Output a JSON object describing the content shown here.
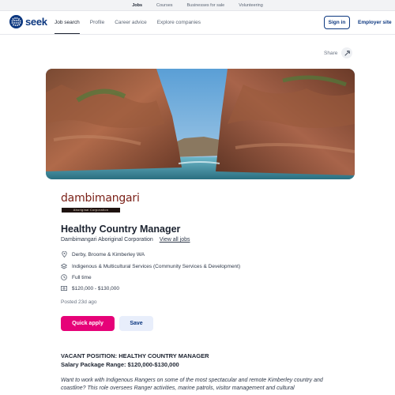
{
  "top_strip": {
    "items": [
      "Jobs",
      "Courses",
      "Businesses for sale",
      "Volunteering"
    ],
    "active_index": 0
  },
  "nav": {
    "logo_text": "seek",
    "links": [
      "Job search",
      "Profile",
      "Career advice",
      "Explore companies"
    ],
    "active_index": 0,
    "sign_in": "Sign in",
    "employer": "Employer site"
  },
  "share": {
    "label": "Share",
    "icon": "share-icon"
  },
  "banner": {
    "description_icon": "gorge-photo"
  },
  "company_logo": {
    "name": "dambimangari",
    "tagline": "Aboriginal Corporation"
  },
  "job": {
    "title": "Healthy Country Manager",
    "company": "Dambimangari Aboriginal Corporation",
    "view_all": "View all jobs",
    "location": "Derby, Broome & Kimberley WA",
    "classification": "Indigenous & Multicultural Services (Community Services & Development)",
    "work_type": "Full time",
    "salary": "$120,000 - $130,000",
    "posted": "Posted 23d ago"
  },
  "actions": {
    "quick_apply": "Quick apply",
    "save": "Save"
  },
  "description": {
    "heading": "VACANT POSITION: HEALTHY COUNTRY MANAGER",
    "salary_line": "Salary Package Range: $120,000-$130,000",
    "intro": "Want to work with Indigenous Rangers on some of the most spectacular and remote Kimberley country and coastline? This role oversees Ranger activities, marine patrols, visitor management and cultural"
  },
  "colors": {
    "brand_blue": "#0d3880",
    "apply_pink": "#e60278",
    "save_bg": "#e8eefb",
    "text_dark": "#1c2330"
  }
}
